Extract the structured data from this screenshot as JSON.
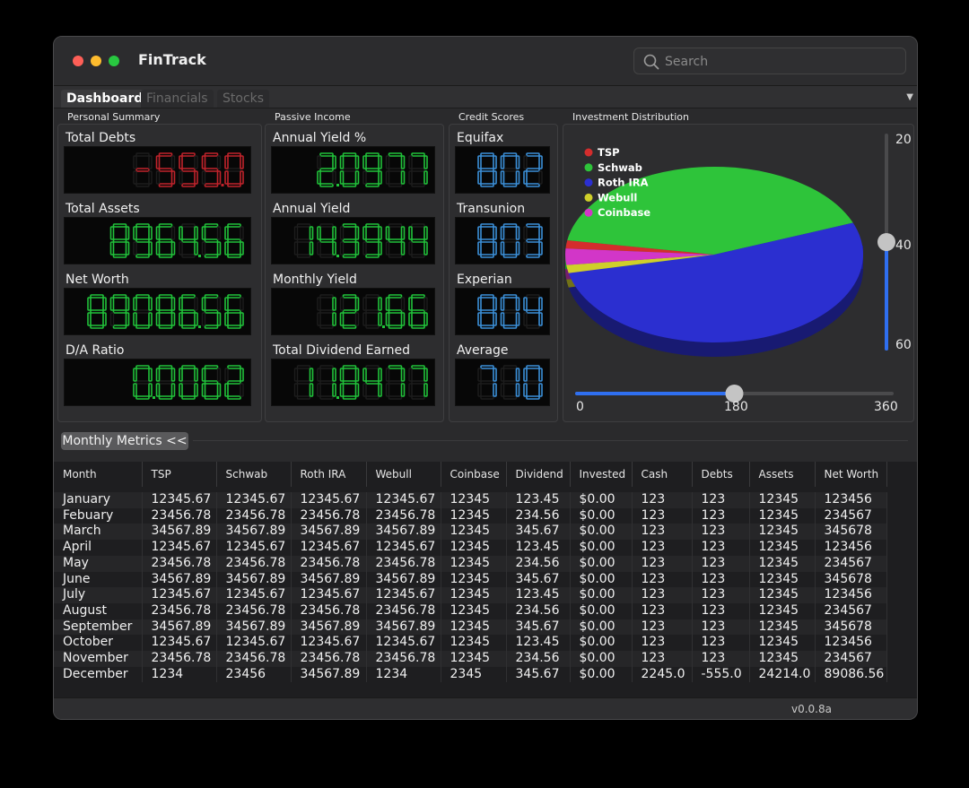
{
  "app": {
    "title": "FinTrack"
  },
  "search": {
    "placeholder": "Search"
  },
  "tabs": [
    {
      "label": "Dashboard",
      "active": true
    },
    {
      "label": "Financials",
      "active": false
    },
    {
      "label": "Stocks",
      "active": false
    }
  ],
  "sections": {
    "personal_summary": "Personal Summary",
    "passive_income": "Passive Income",
    "credit_scores": "Credit Scores",
    "investment_distribution": "Investment Distribution"
  },
  "personal_summary": [
    {
      "label": "Total Debts",
      "value": "-555.0",
      "color": "#c0232b"
    },
    {
      "label": "Total Assets",
      "value": "8964.56",
      "color": "#21c23a"
    },
    {
      "label": "Net Worth",
      "value": "89086.56",
      "color": "#21c23a"
    },
    {
      "label": "D/A Ratio",
      "value": "0.0062",
      "color": "#21c23a"
    }
  ],
  "passive_income": [
    {
      "label": "Annual Yield %",
      "value": "2.0977",
      "color": "#21c23a"
    },
    {
      "label": "Annual Yield",
      "value": "14.3944",
      "color": "#21c23a"
    },
    {
      "label": "Monthly Yield",
      "value": "121.66",
      "color": "#21c23a"
    },
    {
      "label": "Total Dividend Earned",
      "value": "11.8477",
      "color": "#21c23a"
    }
  ],
  "credit_scores": [
    {
      "label": "Equifax",
      "value": "802",
      "color": "#3b8fd8"
    },
    {
      "label": "Transunion",
      "value": "803",
      "color": "#3b8fd8"
    },
    {
      "label": "Experian",
      "value": "804",
      "color": "#3b8fd8"
    },
    {
      "label": "Average",
      "value": "710",
      "color": "#3b8fd8"
    }
  ],
  "chart_data": {
    "type": "pie",
    "series": [
      {
        "name": "TSP",
        "value": 1.5,
        "color": "#d42d2d"
      },
      {
        "name": "Schwab",
        "value": 41.5,
        "color": "#2ec43a"
      },
      {
        "name": "Roth IRA",
        "value": 52.5,
        "color": "#2b2fd0"
      },
      {
        "name": "Webull",
        "value": 1.5,
        "color": "#cfcf2a"
      },
      {
        "name": "Coinbase",
        "value": 3.0,
        "color": "#d236c8"
      }
    ],
    "legend": "top-left"
  },
  "sliders": {
    "vertical": {
      "labels": [
        "20",
        "40",
        "60"
      ],
      "value": 40
    },
    "horizontal": {
      "labels": [
        "0",
        "180",
        "360"
      ],
      "value": 180
    }
  },
  "metrics_button": {
    "label": "Monthly Metrics <<"
  },
  "table": {
    "columns": [
      "Month",
      "TSP",
      "Schwab",
      "Roth IRA",
      "Webull",
      "Coinbase",
      "Dividend",
      "Invested",
      "Cash",
      "Debts",
      "Assets",
      "Net Worth"
    ],
    "rows": [
      [
        "January",
        "12345.67",
        "12345.67",
        "12345.67",
        "12345.67",
        "12345",
        "123.45",
        "$0.00",
        "123",
        "123",
        "12345",
        "123456"
      ],
      [
        "Febuary",
        "23456.78",
        "23456.78",
        "23456.78",
        "23456.78",
        "12345",
        "234.56",
        "$0.00",
        "123",
        "123",
        "12345",
        "234567"
      ],
      [
        "March",
        "34567.89",
        "34567.89",
        "34567.89",
        "34567.89",
        "12345",
        "345.67",
        "$0.00",
        "123",
        "123",
        "12345",
        "345678"
      ],
      [
        "April",
        "12345.67",
        "12345.67",
        "12345.67",
        "12345.67",
        "12345",
        "123.45",
        "$0.00",
        "123",
        "123",
        "12345",
        "123456"
      ],
      [
        "May",
        "23456.78",
        "23456.78",
        "23456.78",
        "23456.78",
        "12345",
        "234.56",
        "$0.00",
        "123",
        "123",
        "12345",
        "234567"
      ],
      [
        "June",
        "34567.89",
        "34567.89",
        "34567.89",
        "34567.89",
        "12345",
        "345.67",
        "$0.00",
        "123",
        "123",
        "12345",
        "345678"
      ],
      [
        "July",
        "12345.67",
        "12345.67",
        "12345.67",
        "12345.67",
        "12345",
        "123.45",
        "$0.00",
        "123",
        "123",
        "12345",
        "123456"
      ],
      [
        "August",
        "23456.78",
        "23456.78",
        "23456.78",
        "23456.78",
        "12345",
        "234.56",
        "$0.00",
        "123",
        "123",
        "12345",
        "234567"
      ],
      [
        "September",
        "34567.89",
        "34567.89",
        "34567.89",
        "34567.89",
        "12345",
        "345.67",
        "$0.00",
        "123",
        "123",
        "12345",
        "345678"
      ],
      [
        "October",
        "12345.67",
        "12345.67",
        "12345.67",
        "12345.67",
        "12345",
        "123.45",
        "$0.00",
        "123",
        "123",
        "12345",
        "123456"
      ],
      [
        "November",
        "23456.78",
        "23456.78",
        "23456.78",
        "23456.78",
        "12345",
        "234.56",
        "$0.00",
        "123",
        "123",
        "12345",
        "234567"
      ],
      [
        "December",
        "1234",
        "23456",
        "34567.89",
        "1234",
        "2345",
        "345.67",
        "$0.00",
        "2245.0",
        "-555.0",
        "24214.0",
        "89086.56"
      ]
    ]
  },
  "status": {
    "version": "v0.0.8a"
  }
}
